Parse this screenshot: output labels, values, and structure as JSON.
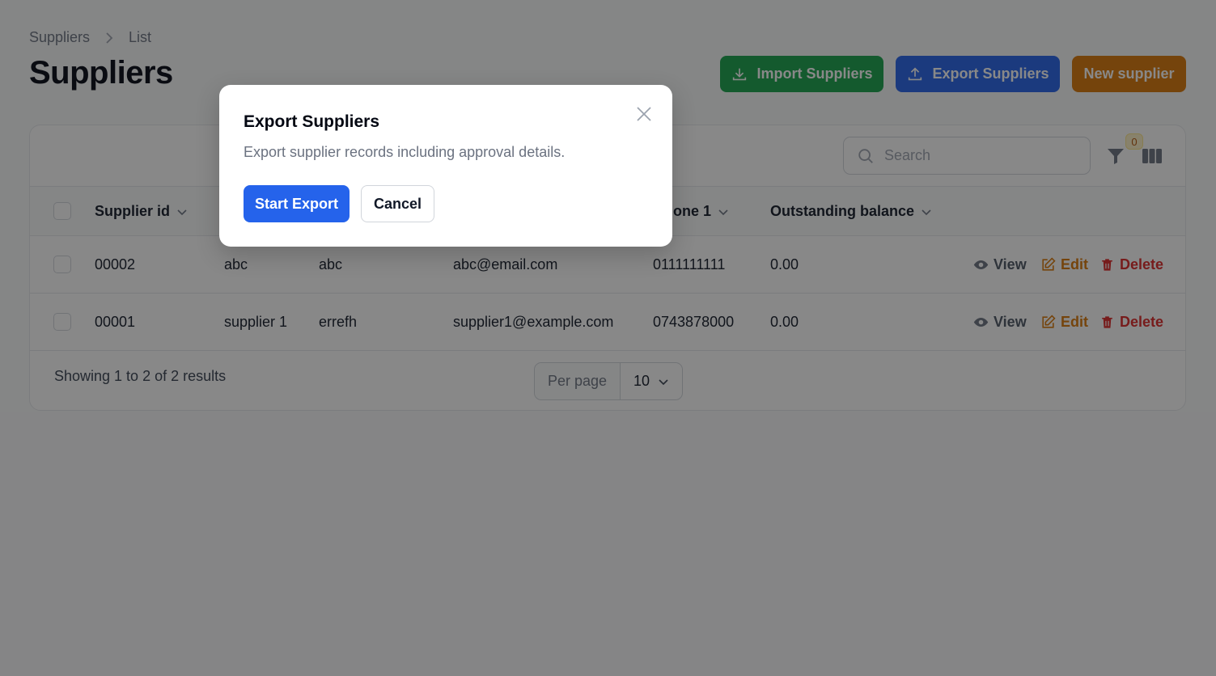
{
  "breadcrumb": {
    "items": [
      "Suppliers",
      "List"
    ]
  },
  "page_title": "Suppliers",
  "header_actions": {
    "import_label": "Import Suppliers",
    "export_label": "Export Suppliers",
    "new_label": "New supplier"
  },
  "colors": {
    "import": "#16a34a",
    "export": "#2563eb",
    "new": "#d97706",
    "delete": "#dc2626"
  },
  "toolbar": {
    "search_placeholder": "Search",
    "filter_count": "0"
  },
  "table": {
    "columns": [
      "Supplier id",
      "one 1",
      "Outstanding balance"
    ],
    "rows": [
      {
        "supplier_id": "00002",
        "name": "abc",
        "contact": "abc",
        "email": "abc@email.com",
        "phone": "0111111111",
        "balance": "0.00"
      },
      {
        "supplier_id": "00001",
        "name": "supplier 1",
        "contact": "errefh",
        "email": "supplier1@example.com",
        "phone": "0743878000",
        "balance": "0.00"
      }
    ],
    "actions": {
      "view": "View",
      "edit": "Edit",
      "delete": "Delete"
    }
  },
  "footer": {
    "summary": "Showing 1 to 2 of 2 results",
    "per_page_label": "Per page",
    "per_page_value": "10"
  },
  "modal": {
    "title": "Export Suppliers",
    "description": "Export supplier records including approval details.",
    "confirm_label": "Start Export",
    "cancel_label": "Cancel"
  }
}
